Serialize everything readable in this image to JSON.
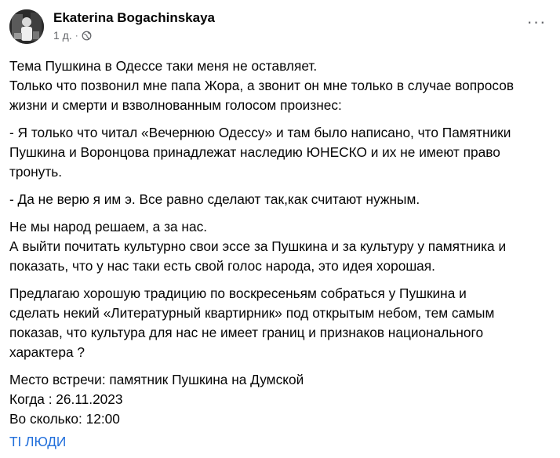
{
  "post": {
    "author": "Ekaterina Bogachinskaya",
    "timestamp": "1 д.",
    "separator": "·",
    "privacy_icon": "globe-icon",
    "more_icon": "more-options-icon",
    "more_label": "···",
    "paragraphs": [
      {
        "lines": [
          "Тема Пушкина в Одессе таки меня не оставляет.",
          "Только что позвонил мне папа Жора, а звонит он мне только в случае вопросов",
          "жизни и смерти и взволнованным голосом произнес:"
        ]
      },
      {
        "lines": [
          "- Я только что читал «Вечернюю Одессу» и там было написано, что Памятники",
          "Пушкина и Воронцова принадлежат наследию ЮНЕСКО и их не имеют право",
          "тронуть."
        ]
      },
      {
        "lines": [
          "- Да не верю я им э. Все равно сделают так,как считают нужным."
        ]
      },
      {
        "lines": [
          "Не мы народ решаем, а за нас.",
          "А выйти почитать культурно свои эссе за Пушкина и за культуру у памятника и",
          "показать, что у нас таки есть свой голос народа, это идея хорошая."
        ]
      },
      {
        "lines": [
          "Предлагаю хорошую традицию по воскресеньям собраться у Пушкина и",
          "сделать некий «Литературный квартирник» под открытым небом, тем самым",
          "показав, что культура для нас не имеет границ и признаков национального",
          "характера ?"
        ]
      },
      {
        "lines": [
          "Место встречи: памятник Пушкина на Думской",
          "Когда : 26.11.2023",
          "Во сколько: 12:00"
        ]
      }
    ],
    "hashtag": "ТІ ЛЮДИ",
    "colors": {
      "text": "#050505",
      "secondary": "#65676b",
      "link": "#216fdb",
      "background": "#ffffff"
    }
  }
}
